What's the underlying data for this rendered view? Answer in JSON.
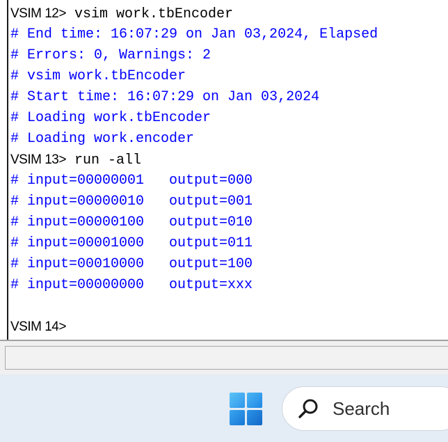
{
  "transcript": {
    "lines": [
      {
        "kind": "cmd",
        "prompt": "VSIM 12>",
        "text": " vsim work.tbEncoder"
      },
      {
        "kind": "comment",
        "text": "# End time: 16:07:29 on Jan 03,2024, Elapsed"
      },
      {
        "kind": "comment",
        "text": "# Errors: 0, Warnings: 2"
      },
      {
        "kind": "comment",
        "text": "# vsim work.tbEncoder"
      },
      {
        "kind": "comment",
        "text": "# Start time: 16:07:29 on Jan 03,2024"
      },
      {
        "kind": "comment",
        "text": "# Loading work.tbEncoder"
      },
      {
        "kind": "comment",
        "text": "# Loading work.encoder"
      },
      {
        "kind": "cmd",
        "prompt": "VSIM 13>",
        "text": " run -all"
      },
      {
        "kind": "comment",
        "text": "# input=00000001   output=000"
      },
      {
        "kind": "comment",
        "text": "# input=00000010   output=001"
      },
      {
        "kind": "comment",
        "text": "# input=00000100   output=010"
      },
      {
        "kind": "comment",
        "text": "# input=00001000   output=011"
      },
      {
        "kind": "comment",
        "text": "# input=00010000   output=100"
      },
      {
        "kind": "comment",
        "text": "# input=00000000   output=xxx"
      },
      {
        "kind": "blank",
        "text": ""
      },
      {
        "kind": "cmd",
        "prompt": "VSIM 14>",
        "text": ""
      }
    ],
    "colors": {
      "comment": "#0000ff",
      "command": "#000000"
    }
  },
  "taskbar": {
    "start_icon": "windows-logo-icon",
    "search": {
      "icon": "search-icon",
      "label": "Search"
    },
    "colors": {
      "background": "#e4ecf5",
      "start_dark": "#1a73d9",
      "start_light": "#5cc3f7"
    }
  }
}
